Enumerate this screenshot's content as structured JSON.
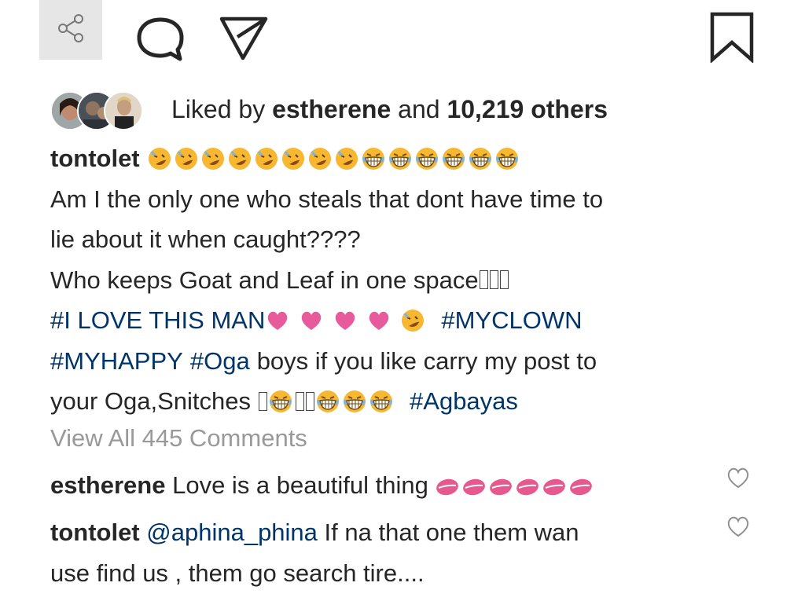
{
  "actions": {
    "share_icon": "share-icon",
    "comment_icon": "comment-bubble-icon",
    "send_icon": "paper-plane-icon",
    "bookmark_icon": "bookmark-icon"
  },
  "likes": {
    "prefix": "Liked by",
    "first_liker": "estherene",
    "connector": "and",
    "others": "10,219 others"
  },
  "caption": {
    "username": "tontolet",
    "line1": "Am I the only one who steals that dont have time to",
    "line2": "lie about it when caught????",
    "line3": "Who keeps Goat and Leaf in one space",
    "tag1": "#I LOVE THIS MAN",
    "tag2": "#MYCLOWN",
    "tag3": "#MYHAPPY",
    "tag4": "#Oga",
    "line5_text": "boys if you like carry my post to",
    "line6_text": "your Oga,Snitches",
    "tag5": "#Agbayas"
  },
  "view_all": "View All 445 Comments",
  "comments": [
    {
      "username": "estherene",
      "text": "Love is a beautiful thing"
    },
    {
      "username": "tontolet",
      "mention": "@aphina_phina",
      "text": "If na that one them wan",
      "text2": "use find us , them go search tire...."
    }
  ],
  "colors": {
    "text": "#262626",
    "hashtag": "#003569",
    "muted": "#999999",
    "heart": "#e75a9b",
    "emoji_yellow": "#f7b731"
  }
}
